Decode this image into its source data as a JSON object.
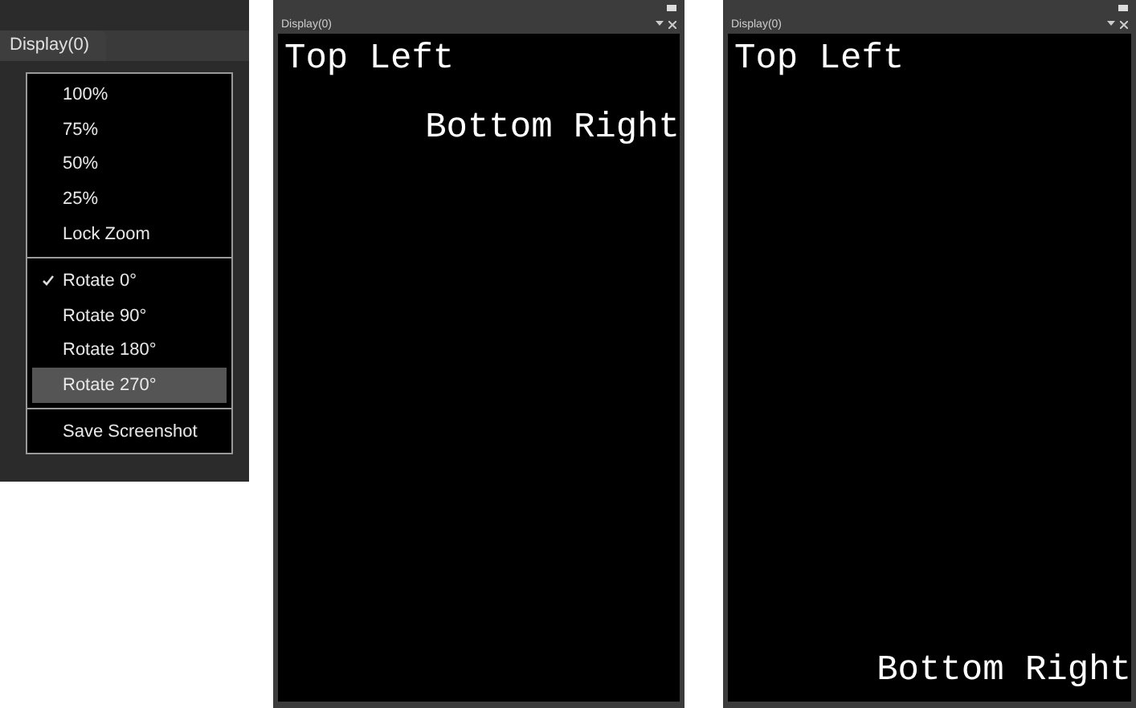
{
  "menu_panel": {
    "tab": "Display(0)",
    "menu": [
      {
        "kind": "item",
        "label": "100%",
        "checked": false,
        "selected": false
      },
      {
        "kind": "item",
        "label": "75%",
        "checked": false,
        "selected": false
      },
      {
        "kind": "item",
        "label": "50%",
        "checked": false,
        "selected": false
      },
      {
        "kind": "item",
        "label": "25%",
        "checked": false,
        "selected": false
      },
      {
        "kind": "item",
        "label": "Lock Zoom",
        "checked": false,
        "selected": false
      },
      {
        "kind": "separator"
      },
      {
        "kind": "item",
        "label": "Rotate 0°",
        "checked": true,
        "selected": false
      },
      {
        "kind": "item",
        "label": "Rotate 90°",
        "checked": false,
        "selected": false
      },
      {
        "kind": "item",
        "label": "Rotate 180°",
        "checked": false,
        "selected": false
      },
      {
        "kind": "item",
        "label": "Rotate 270°",
        "checked": false,
        "selected": true
      },
      {
        "kind": "separator"
      },
      {
        "kind": "item",
        "label": "Save Screenshot",
        "checked": false,
        "selected": false
      }
    ]
  },
  "displays": [
    {
      "title": "Display(0)",
      "texts": [
        {
          "text": "Top Left",
          "kind": "top"
        },
        {
          "text": "Bottom Right",
          "kind": "second"
        }
      ]
    },
    {
      "title": "Display(0)",
      "texts": [
        {
          "text": "Top Left",
          "kind": "top"
        },
        {
          "text": "Bottom Right",
          "kind": "bottom"
        }
      ]
    }
  ]
}
